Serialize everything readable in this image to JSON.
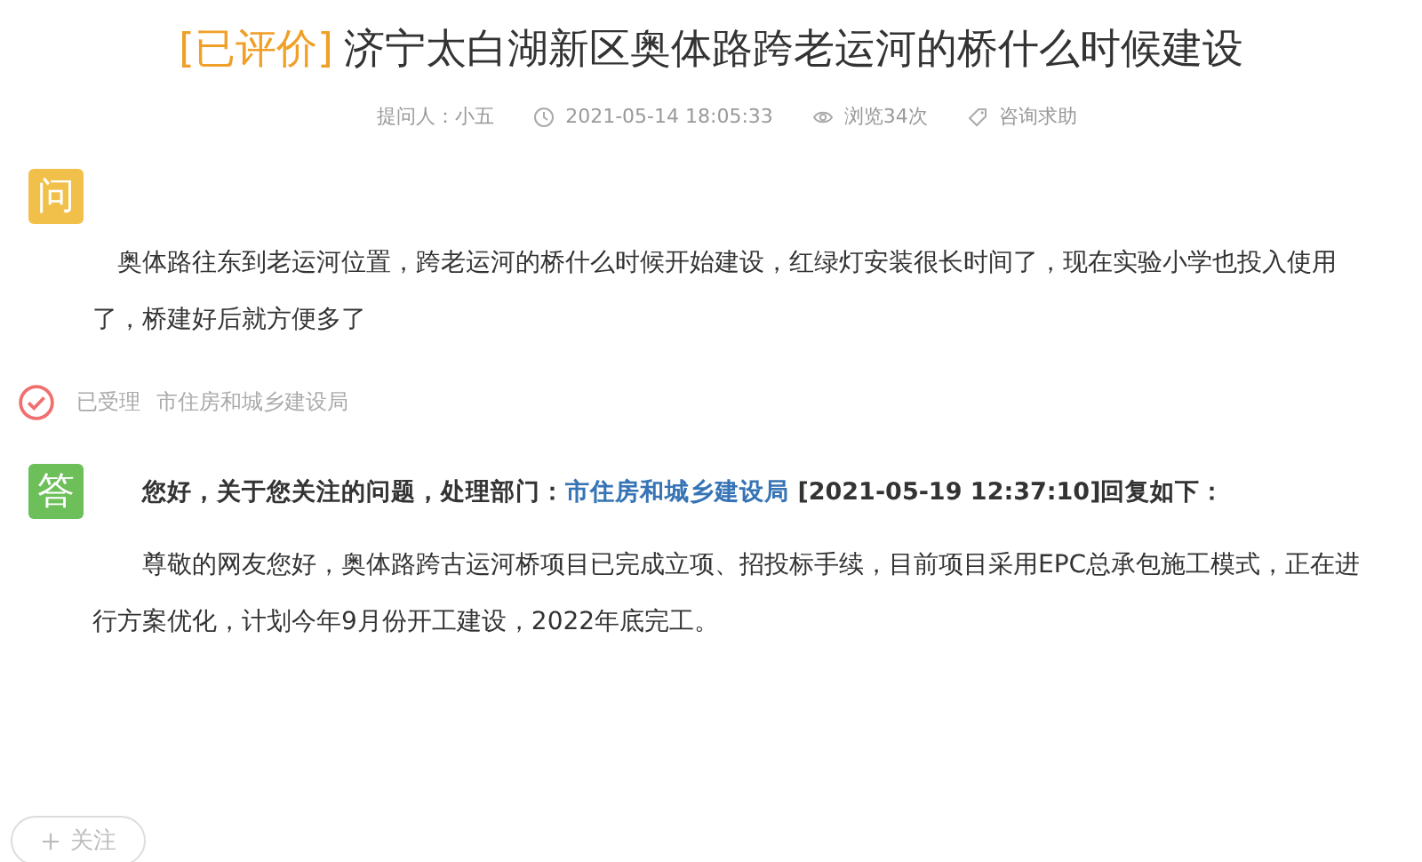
{
  "title": {
    "tag": "[已评价]",
    "text": "济宁太白湖新区奥体路跨老运河的桥什么时候建设"
  },
  "meta": {
    "asker": "提问人：小五",
    "time": "2021-05-14 18:05:33",
    "views": "浏览34次",
    "category": "咨询求助"
  },
  "question": {
    "badge": "问",
    "text": "奥体路往东到老运河位置，跨老运河的桥什么时候开始建设，红绿灯安装很长时间了，现在实验小学也投入使用了，桥建好后就方便多了"
  },
  "status": {
    "label": "已受理",
    "department": "市住房和城乡建设局"
  },
  "answer": {
    "badge": "答",
    "intro": "您好，关于您关注的问题，处理部门：",
    "department": "市住房和城乡建设局",
    "outro": " [2021-05-19 12:37:10]回复如下：",
    "text": "尊敬的网友您好，奥体路跨古运河桥项目已完成立项、招投标手续，目前项目采用EPC总承包施工模式，正在进行方案优化，计划今年9月份开工建设，2022年底完工。"
  },
  "follow_button": {
    "label": "关注"
  }
}
